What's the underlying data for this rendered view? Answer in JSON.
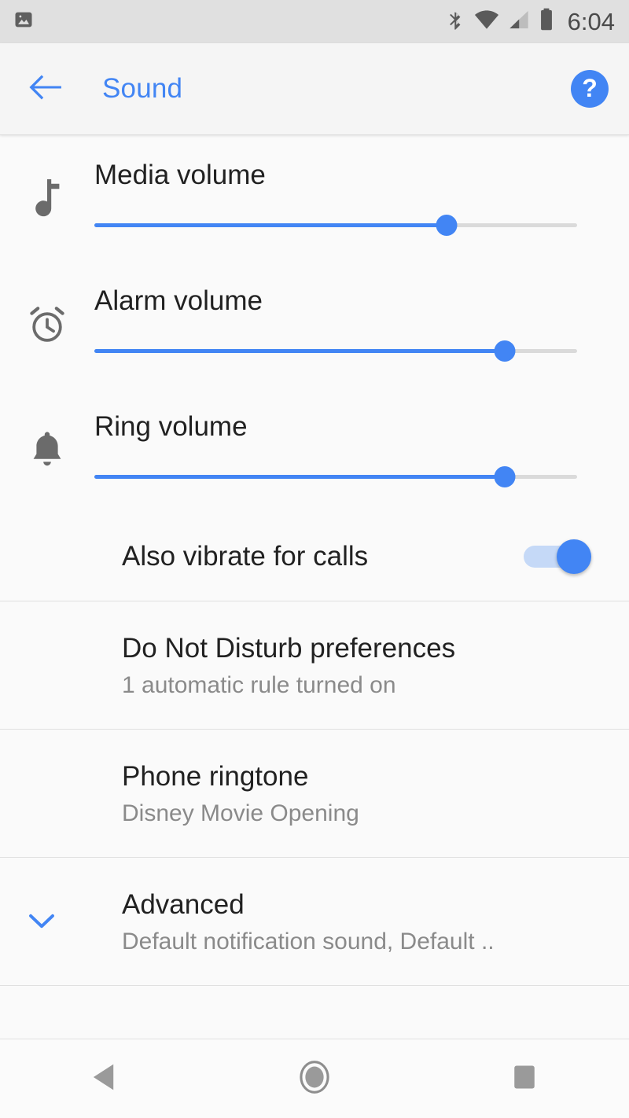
{
  "statusbar": {
    "time": "6:04",
    "icons": [
      "screenshot-image-icon",
      "bluetooth-icon",
      "wifi-icon",
      "cellular-signal-icon",
      "battery-icon"
    ]
  },
  "toolbar": {
    "back_icon": "back-arrow-icon",
    "title": "Sound",
    "help_icon": "help-icon",
    "help_label": "?",
    "accent_color": "#4285f4"
  },
  "volume_rows": [
    {
      "icon": "music-note-icon",
      "label": "Media volume",
      "value_percent": 73
    },
    {
      "icon": "alarm-clock-icon",
      "label": "Alarm volume",
      "value_percent": 85
    },
    {
      "icon": "bell-icon",
      "label": "Ring volume",
      "value_percent": 85
    }
  ],
  "vibrate": {
    "label": "Also vibrate for calls",
    "state": "on"
  },
  "preferences": [
    {
      "title": "Do Not Disturb preferences",
      "subtitle": "1 automatic rule turned on"
    },
    {
      "title": "Phone ringtone",
      "subtitle": "Disney Movie Opening"
    }
  ],
  "advanced": {
    "chevron_icon": "chevron-down-icon",
    "title": "Advanced",
    "subtitle": "Default notification sound, Default .."
  },
  "navbar": {
    "back": "nav-back-icon",
    "home": "nav-home-icon",
    "recents": "nav-recents-icon"
  }
}
